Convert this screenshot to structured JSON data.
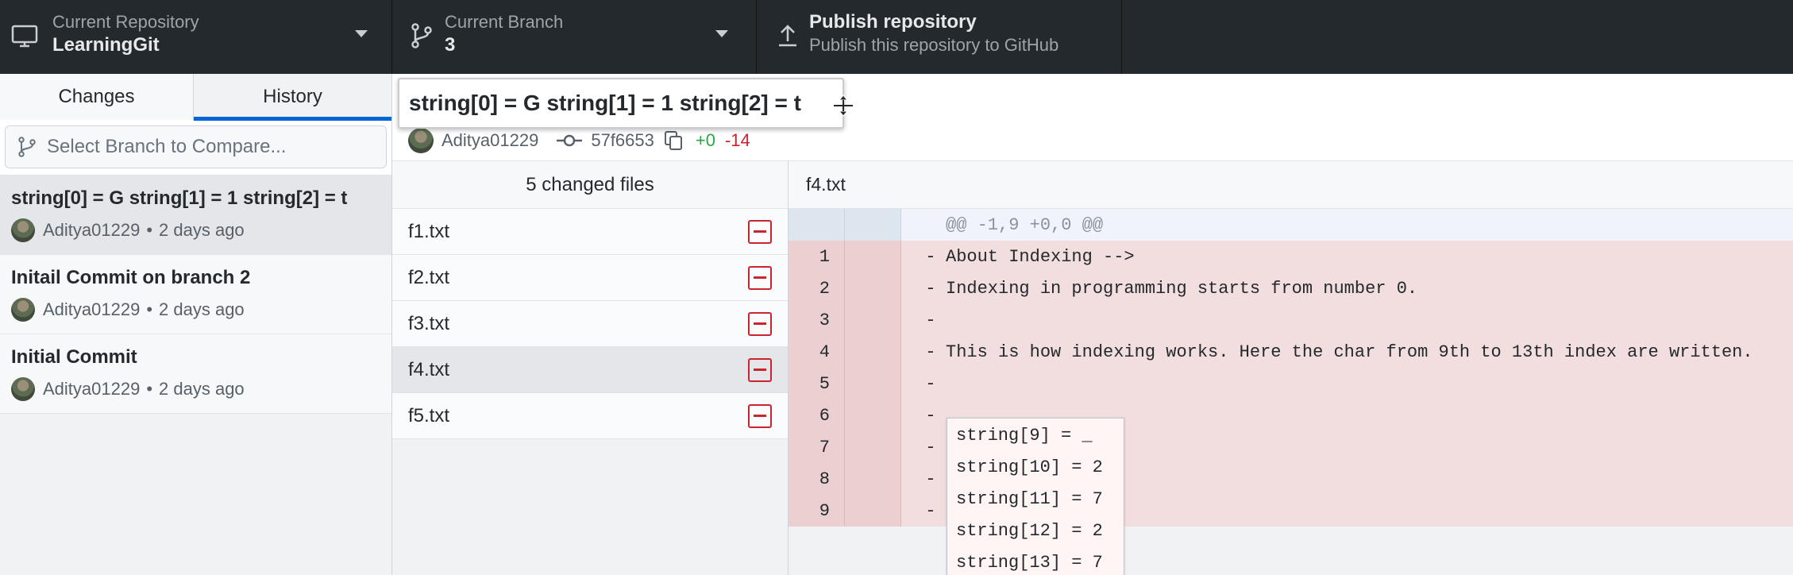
{
  "toolbar": {
    "repository": {
      "title": "Current Repository",
      "value": "LearningGit"
    },
    "branch": {
      "title": "Current Branch",
      "value": "3"
    },
    "publish": {
      "title": "Publish repository",
      "subtitle": "Publish this repository to GitHub"
    }
  },
  "sidebar": {
    "tabs": [
      {
        "label": "Changes"
      },
      {
        "label": "History"
      }
    ],
    "compare_placeholder": "Select Branch to Compare...",
    "commits": [
      {
        "summary": "string[0] = G string[1] = 1 string[2] = t",
        "author": "Aditya01229",
        "time": "2 days ago"
      },
      {
        "summary": "Initail Commit on branch 2",
        "author": "Aditya01229",
        "time": "2 days ago"
      },
      {
        "summary": "Initial Commit",
        "author": "Aditya01229",
        "time": "2 days ago"
      }
    ],
    "separator": "•"
  },
  "commit_header": {
    "summary": "string[0] = G string[1] = 1 string[2] = t",
    "author": "Aditya01229",
    "sha": "57f6653",
    "additions": "+0",
    "deletions": "-14"
  },
  "file_list": {
    "header": "5 changed files",
    "files": [
      {
        "name": "f1.txt",
        "status": "deleted"
      },
      {
        "name": "f2.txt",
        "status": "deleted"
      },
      {
        "name": "f3.txt",
        "status": "deleted"
      },
      {
        "name": "f4.txt",
        "status": "deleted"
      },
      {
        "name": "f5.txt",
        "status": "deleted"
      }
    ]
  },
  "diff": {
    "file": "f4.txt",
    "hunk": "@@ -1,9 +0,0 @@",
    "marker": "-",
    "lines": [
      {
        "num": "1",
        "text": "About Indexing -->"
      },
      {
        "num": "2",
        "text": "Indexing in programming starts from number 0."
      },
      {
        "num": "3",
        "text": ""
      },
      {
        "num": "4",
        "text": "This is how indexing works. Here the char from 9th to 13th index are written."
      },
      {
        "num": "5",
        "text": "string[9] = _"
      },
      {
        "num": "6",
        "text": "string[10] = 2"
      },
      {
        "num": "7",
        "text": "string[11] = 7"
      },
      {
        "num": "8",
        "text": "string[12] = 2"
      },
      {
        "num": "9",
        "text": "string[13] = 7"
      }
    ]
  },
  "colors": {
    "toolbar_bg": "#24292e",
    "accent": "#0366d6",
    "deletion": "#cb2431",
    "addition": "#28a745"
  }
}
